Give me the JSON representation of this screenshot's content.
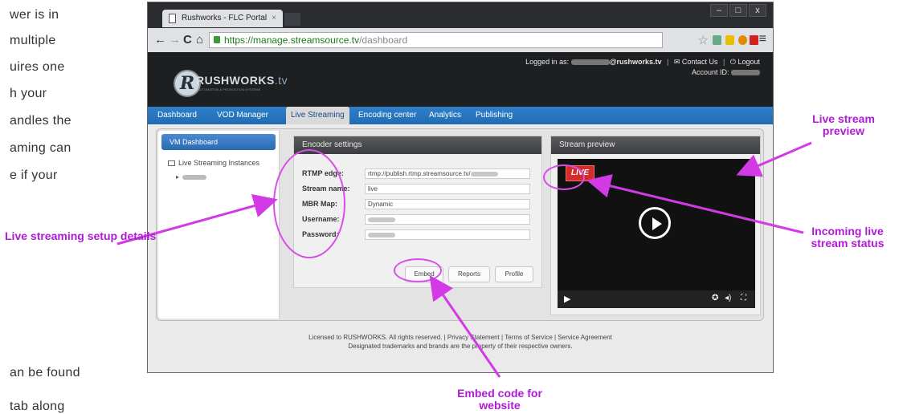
{
  "document_fragments": [
    "wer is in",
    "multiple",
    "uires one",
    "h your",
    "andles the",
    "aming can",
    "e if your",
    "an be found",
    "tab  along"
  ],
  "browser": {
    "tab_title": "Rushworks - FLC Portal",
    "tab_close": "×",
    "window_controls": [
      "–",
      "□",
      "x"
    ],
    "url_host": "https://manage.streamsource.tv",
    "url_path": "/dashboard"
  },
  "site": {
    "logo_name": "RUSHWORKS",
    "logo_suffix": ".tv",
    "logo_tagline": "AUTOMATION & PRODUCTION SYSTEMS",
    "logged_in_label": "Logged in as:",
    "logged_in_user": "@rushworks.tv",
    "contact": "Contact Us",
    "logout": "Logout",
    "account_label": "Account ID:",
    "nav": [
      "Dashboard",
      "VOD Manager",
      "Live Streaming",
      "Encoding center",
      "Analytics",
      "Publishing"
    ],
    "active_nav": "Live Streaming",
    "sidebar_title": "VM Dashboard",
    "sidebar_link": "Live Streaming Instances"
  },
  "encoder": {
    "title": "Encoder settings",
    "fields": [
      {
        "label": "RTMP edge:",
        "value": "rtmp://publish.rtmp.streamsource.tv/"
      },
      {
        "label": "Stream name:",
        "value": "live"
      },
      {
        "label": "MBR Map:",
        "value": "Dynamic"
      },
      {
        "label": "Username:",
        "value": ""
      },
      {
        "label": "Password:",
        "value": ""
      }
    ],
    "buttons": [
      "Embed",
      "Reports",
      "Profile"
    ]
  },
  "preview": {
    "title": "Stream preview",
    "live_badge": "LIVE"
  },
  "footer": {
    "line1": "Licensed to RUSHWORKS. All rights reserved. | Privacy Statement | Terms of Service | Service Agreement",
    "line2": "Designated trademarks and brands are the property of their respective owners."
  },
  "annotations": {
    "live_setup": "Live streaming setup details",
    "stream_preview": "Live stream preview",
    "incoming_status": "Incoming live stream status",
    "embed_code": "Embed code for website",
    "color": "#b01ad6"
  }
}
